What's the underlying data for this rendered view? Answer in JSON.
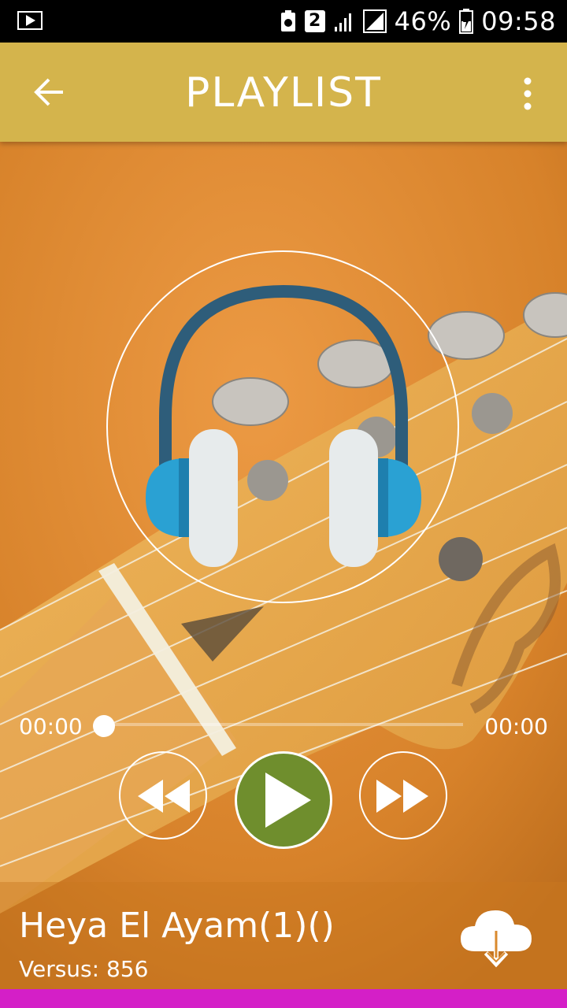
{
  "status_bar": {
    "sim_badge": "2",
    "battery": "46%",
    "time": "09:58"
  },
  "app_bar": {
    "title": "PLAYLIST"
  },
  "player": {
    "elapsed": "00:00",
    "duration": "00:00",
    "progress": 0
  },
  "track": {
    "title": "Heya El Ayam(1)()",
    "meta": "Versus: 856"
  },
  "colors": {
    "app_bar": "#d4b44c",
    "background": "#d98a2e",
    "play_button": "#6f8e2d",
    "bottom_strip": "#d41fc7"
  },
  "icons": {
    "status_play": "play-store-icon",
    "back": "arrow-left-icon",
    "menu": "more-vertical-icon",
    "center": "headphones-icon",
    "rewind": "rewind-icon",
    "play": "play-icon",
    "forward": "fast-forward-icon",
    "download": "cloud-download-icon"
  }
}
